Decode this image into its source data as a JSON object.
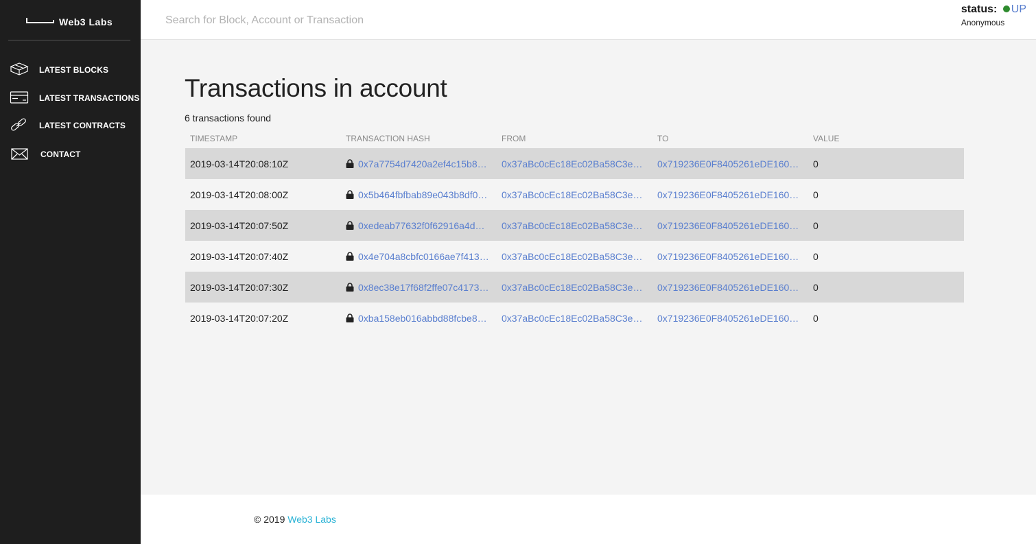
{
  "brand": {
    "name": "Web3  Labs",
    "logo_icon": "bracket-line-logo"
  },
  "sidebar": {
    "items": [
      {
        "label": "LATEST BLOCKS",
        "icon": "blocks-icon"
      },
      {
        "label": "LATEST TRANSACTIONS",
        "icon": "card-icon"
      },
      {
        "label": "LATEST CONTRACTS",
        "icon": "link-icon"
      },
      {
        "label": "CONTACT",
        "icon": "envelope-icon"
      }
    ]
  },
  "header": {
    "search_placeholder": "Search for Block, Account or Transaction",
    "status_label": "status:",
    "status_value": "UP",
    "status_color": "#2e8b2e",
    "user": "Anonymous"
  },
  "main": {
    "title": "Transactions in account",
    "count_text": "6 transactions found",
    "columns": [
      "TIMESTAMP",
      "TRANSACTION HASH",
      "FROM",
      "TO",
      "VALUE"
    ],
    "rows": [
      {
        "timestamp": "2019-03-14T20:08:10Z",
        "hash": "0x7a7754d7420a2ef4c15b8…",
        "from": "0x37aBc0cEc18Ec02Ba58C3e…",
        "to": "0x719236E0F8405261eDE160…",
        "value": "0"
      },
      {
        "timestamp": "2019-03-14T20:08:00Z",
        "hash": "0x5b464fbfbab89e043b8df0…",
        "from": "0x37aBc0cEc18Ec02Ba58C3e…",
        "to": "0x719236E0F8405261eDE160…",
        "value": "0"
      },
      {
        "timestamp": "2019-03-14T20:07:50Z",
        "hash": "0xedeab77632f0f62916a4d…",
        "from": "0x37aBc0cEc18Ec02Ba58C3e…",
        "to": "0x719236E0F8405261eDE160…",
        "value": "0"
      },
      {
        "timestamp": "2019-03-14T20:07:40Z",
        "hash": "0x4e704a8cbfc0166ae7f413…",
        "from": "0x37aBc0cEc18Ec02Ba58C3e…",
        "to": "0x719236E0F8405261eDE160…",
        "value": "0"
      },
      {
        "timestamp": "2019-03-14T20:07:30Z",
        "hash": "0x8ec38e17f68f2ffe07c4173…",
        "from": "0x37aBc0cEc18Ec02Ba58C3e…",
        "to": "0x719236E0F8405261eDE160…",
        "value": "0"
      },
      {
        "timestamp": "2019-03-14T20:07:20Z",
        "hash": "0xba158eb016abbd88fcbe8…",
        "from": "0x37aBc0cEc18Ec02Ba58C3e…",
        "to": "0x719236E0F8405261eDE160…",
        "value": "0"
      }
    ]
  },
  "footer": {
    "copyright": "© 2019 ",
    "link_text": "Web3 Labs"
  },
  "colors": {
    "sidebar": "#1e1e1e",
    "link": "#5a7fcf",
    "footer_link": "#2bb3d6",
    "row_shade": "#d8d8d8"
  }
}
